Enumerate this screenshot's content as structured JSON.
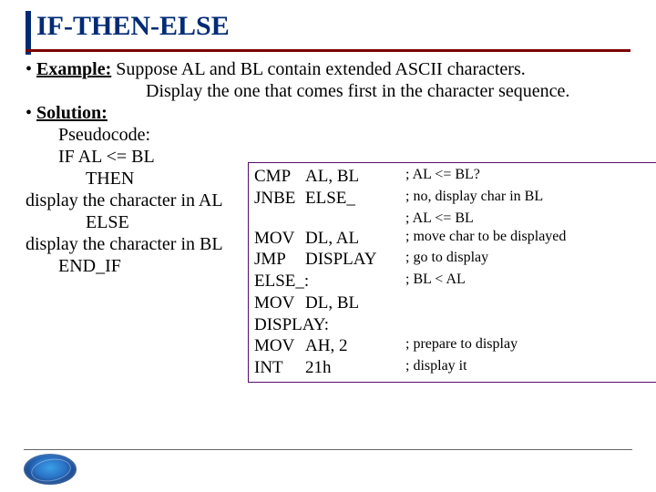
{
  "title": "IF-THEN-ELSE",
  "example_label": "Example:",
  "example_text_l1": " Suppose AL and BL contain extended ASCII characters.",
  "example_text_l2": "Display the one that comes first in the character sequence.",
  "solution_label": "Solution:",
  "pseudo_label": "Pseudocode:",
  "ps_if": "IF AL <= BL",
  "ps_then": "THEN",
  "ps_then_body": "display the character in AL",
  "ps_else": "ELSE",
  "ps_else_body": "display the character in BL",
  "ps_endif": "END_IF",
  "code": [
    {
      "op": "CMP",
      "arg": "AL, BL",
      "cmt": "; AL <= BL?"
    },
    {
      "op": "JNBE",
      "arg": "ELSE_",
      "cmt": "; no, display char in BL"
    },
    {
      "op": "",
      "arg": "",
      "cmt": "; AL <= BL"
    },
    {
      "op": "MOV",
      "arg": "DL, AL",
      "cmt": "; move char to be displayed"
    },
    {
      "op": "JMP",
      "arg": "DISPLAY",
      "cmt": "; go to display"
    },
    {
      "op": "ELSE_:",
      "arg": "",
      "cmt": "; BL < AL"
    },
    {
      "op": "MOV",
      "arg": "DL, BL",
      "cmt": ""
    },
    {
      "op": "DISPLAY:",
      "arg": "",
      "cmt": ""
    },
    {
      "op": "MOV",
      "arg": "AH, 2",
      "cmt": "; prepare to display"
    },
    {
      "op": "INT",
      "arg": "21h",
      "cmt": "; display it"
    }
  ]
}
